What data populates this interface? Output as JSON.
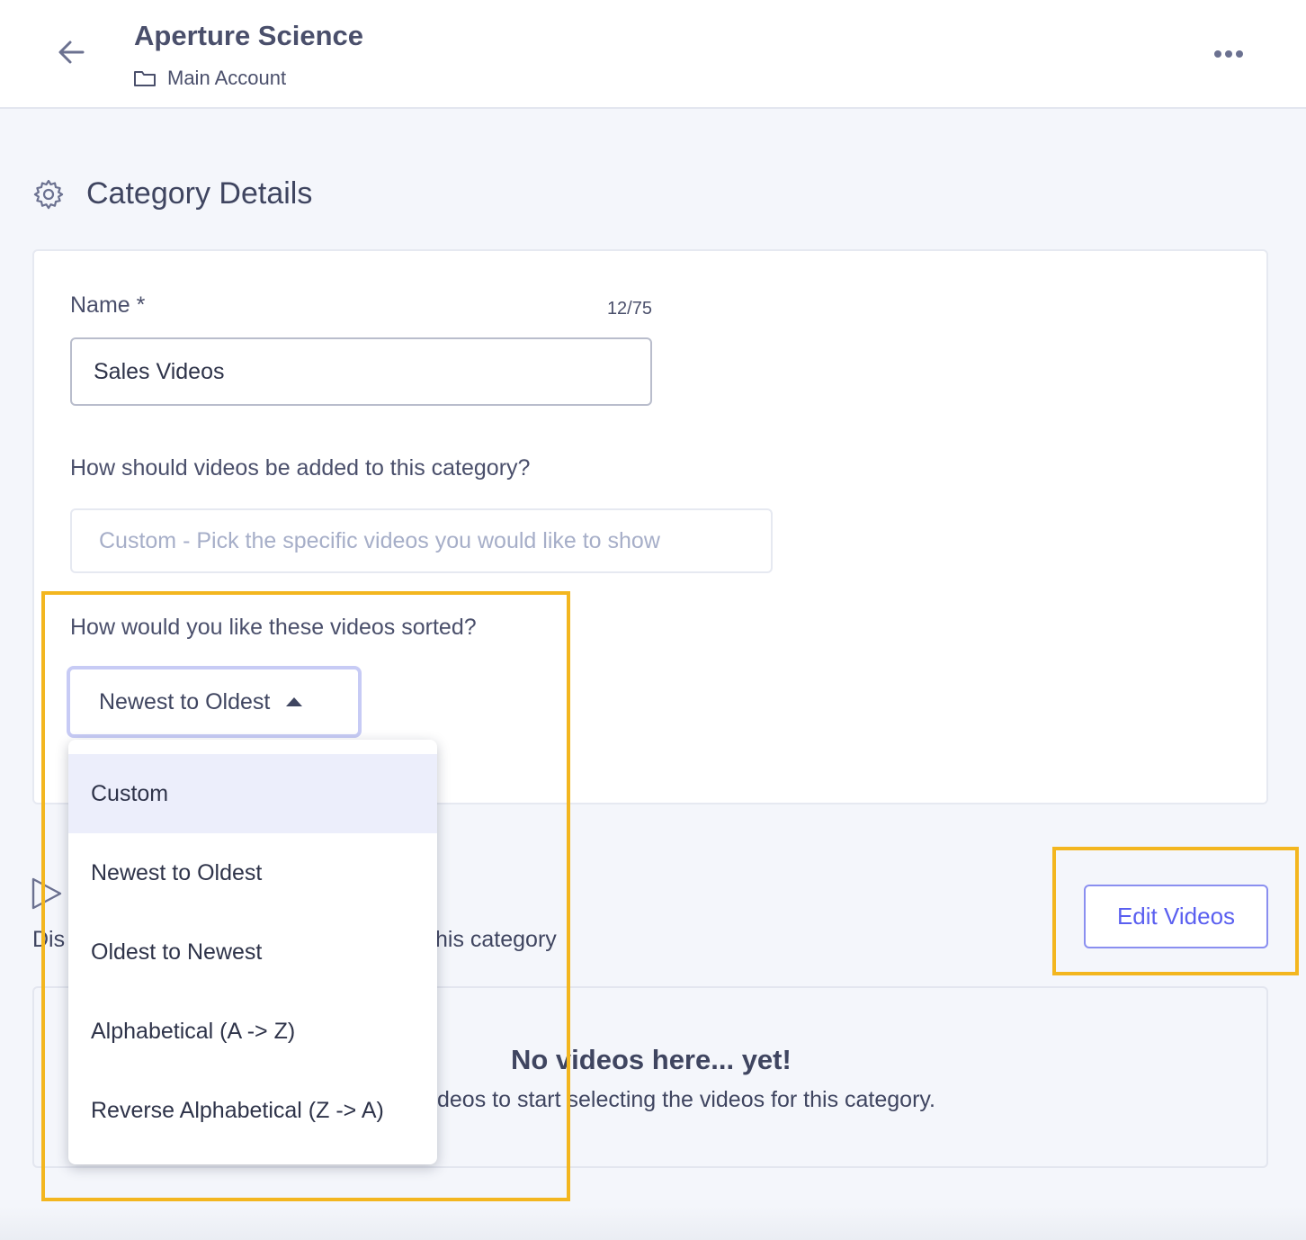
{
  "header": {
    "title": "Aperture Science",
    "account": "Main Account",
    "icons": {
      "back": "arrow-left-icon",
      "folder": "folder-icon",
      "more": "more-horizontal-icon"
    }
  },
  "section": {
    "title": "Category Details",
    "icon": "gear-icon"
  },
  "form": {
    "name_label": "Name *",
    "name_counter": "12/75",
    "name_value": "Sales Videos",
    "method_question": "How should videos be added to this category?",
    "method_value": "Custom - Pick the specific videos you would like to show",
    "sort_question": "How would you like these videos sorted?",
    "sort_value": "Newest to Oldest"
  },
  "sort_options": [
    {
      "label": "Custom",
      "highlighted": true
    },
    {
      "label": "Newest to Oldest",
      "highlighted": false
    },
    {
      "label": "Oldest to Newest",
      "highlighted": false
    },
    {
      "label": "Alphabetical (A -> Z)",
      "highlighted": false
    },
    {
      "label": "Reverse Alphabetical (Z -> A)",
      "highlighted": false
    }
  ],
  "videos": {
    "desc_left_fragment": "Dis",
    "desc_right_fragment": "his category",
    "edit_button": "Edit Videos",
    "empty_title": "No videos here... yet!",
    "empty_subtitle": "deos to start selecting the videos for this category."
  },
  "colors": {
    "accent": "#5a5ff0",
    "highlight": "#f3b61f",
    "background": "#f4f6fb"
  }
}
